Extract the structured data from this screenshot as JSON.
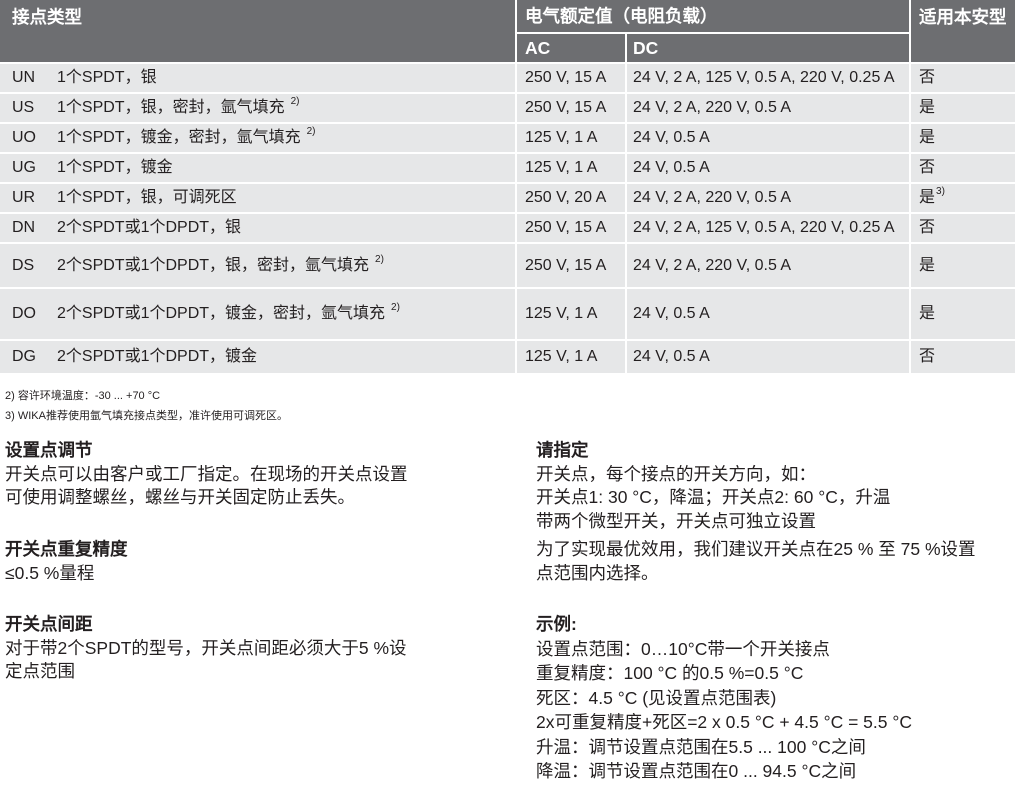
{
  "colors": {
    "header_bg": "#6d6e71",
    "row_bg": "#e6e7e8",
    "text": "#231f20",
    "header_text": "#ffffff"
  },
  "table": {
    "header": {
      "contact_type": "接点类型",
      "rating": "电气额定值（电阻负载）",
      "ac": "AC",
      "dc": "DC",
      "intrinsic_safety": "适用本安型"
    },
    "rows": [
      {
        "code": "UN",
        "desc": "1个SPDT，银",
        "ac": "250 V, 15 A",
        "dc": "24 V, 2 A, 125 V, 0.5 A, 220 V, 0.25 A",
        "safe": "否"
      },
      {
        "code": "US",
        "desc": "1个SPDT，银，密封，氩气填充",
        "desc_note": "2)",
        "ac": "250 V, 15 A",
        "dc": "24 V, 2 A, 220 V, 0.5 A",
        "safe": "是"
      },
      {
        "code": "UO",
        "desc": "1个SPDT，镀金，密封，氩气填充",
        "desc_note": "2)",
        "ac": "125 V, 1 A",
        "dc": "24 V, 0.5 A",
        "safe": "是"
      },
      {
        "code": "UG",
        "desc": "1个SPDT，镀金",
        "ac": "125 V, 1 A",
        "dc": "24 V, 0.5 A",
        "safe": "否"
      },
      {
        "code": "UR",
        "desc": "1个SPDT，银，可调死区",
        "ac": "250 V, 20 A",
        "dc": "24 V, 2 A, 220 V, 0.5 A",
        "safe": "是",
        "safe_note": "3)"
      },
      {
        "code": "DN",
        "desc": "2个SPDT或1个DPDT，银",
        "ac": "250 V, 15 A",
        "dc": "24 V, 2 A, 125 V, 0.5 A, 220 V, 0.25 A",
        "safe": "否"
      },
      {
        "code": "DS",
        "desc": "2个SPDT或1个DPDT，银，密封，氩气填充",
        "desc_note": "2)",
        "ac": "250 V, 15 A",
        "dc": "24 V, 2 A, 220 V, 0.5 A",
        "safe": "是"
      },
      {
        "code": "DO",
        "desc": "2个SPDT或1个DPDT，镀金，密封，氩气填充",
        "desc_note": "2)",
        "ac": "125 V, 1 A",
        "dc": "24 V, 0.5 A",
        "safe": "是"
      },
      {
        "code": "DG",
        "desc": "2个SPDT或1个DPDT，镀金",
        "ac": "125 V, 1 A",
        "dc": "24 V, 0.5 A",
        "safe": "否"
      }
    ]
  },
  "footnotes": [
    "2) 容许环境温度：-30 ... +70 °C",
    "3) WIKA推荐使用氩气填充接点类型，准许使用可调死区。"
  ],
  "sections": {
    "left": [
      {
        "heading": "设置点调节",
        "lines": [
          "开关点可以由客户或工厂指定。在现场的开关点设置",
          "可使用调整螺丝，螺丝与开关固定防止丢失。"
        ]
      },
      {
        "heading": "开关点重复精度",
        "lines": [
          "≤0.5 %量程"
        ]
      },
      {
        "heading": "开关点间距",
        "lines": [
          "对于带2个SPDT的型号，开关点间距必须大于5 %设",
          "定点范围"
        ]
      }
    ],
    "right": [
      {
        "heading": "请指定",
        "lines": [
          "开关点，每个接点的开关方向，如：",
          "开关点1: 30 °C，降温；开关点2: 60 °C，升温",
          "带两个微型开关，开关点可独立设置"
        ]
      },
      {
        "lines": [
          "为了实现最优效用，我们建议开关点在25 % 至 75 %设置",
          "点范围内选择。"
        ]
      },
      {
        "heading": "示例:",
        "lines": [
          "设置点范围：0…10°C带一个开关接点",
          "重复精度：100 °C 的0.5 %=0.5 °C",
          "死区：4.5 °C (见设置点范围表)",
          "2x可重复精度+死区=2 x 0.5 °C + 4.5 °C = 5.5 °C",
          "升温：调节设置点范围在5.5 ... 100 °C之间",
          "降温：调节设置点范围在0 ... 94.5 °C之间"
        ]
      }
    ]
  }
}
